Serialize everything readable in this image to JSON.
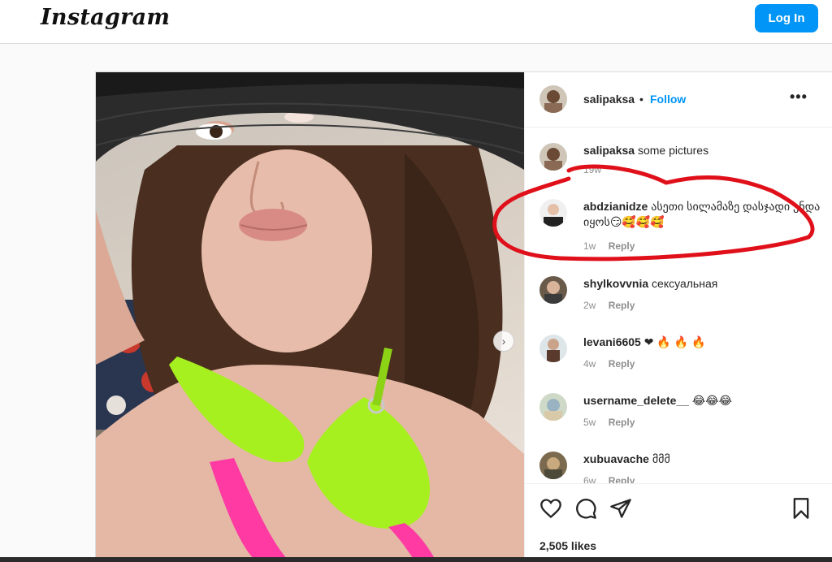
{
  "app": {
    "logo": "Instagram",
    "login_label": "Log In"
  },
  "post": {
    "username": "salipaksa",
    "separator": "•",
    "follow_label": "Follow",
    "more_label": "•••",
    "next_label": "›",
    "likes": "2,505 likes"
  },
  "comments": [
    {
      "user": "salipaksa",
      "text": "some pictures",
      "age": "19w",
      "reply": ""
    },
    {
      "user": "abdzianidze",
      "text": "ასეთი სილამაზე დასჯადი უნდა იყოს😏🥰🥰🥰",
      "age": "1w",
      "reply": "Reply"
    },
    {
      "user": "shylkovvnia",
      "text": "сексуальная",
      "age": "2w",
      "reply": "Reply"
    },
    {
      "user": "levani6605",
      "text": "❤ 🔥 🔥 🔥",
      "age": "4w",
      "reply": "Reply"
    },
    {
      "user": "username_delete__",
      "text": "😂😂😂",
      "age": "5w",
      "reply": "Reply"
    },
    {
      "user": "xubuavache",
      "text": "მმმ",
      "age": "6w",
      "reply": "Reply"
    }
  ],
  "colors": {
    "accent": "#0095f6",
    "annotation": "#e0101a"
  },
  "icons": [
    "heart-icon",
    "comment-icon",
    "share-icon",
    "bookmark-icon",
    "more-icon",
    "chevron-right-icon"
  ]
}
